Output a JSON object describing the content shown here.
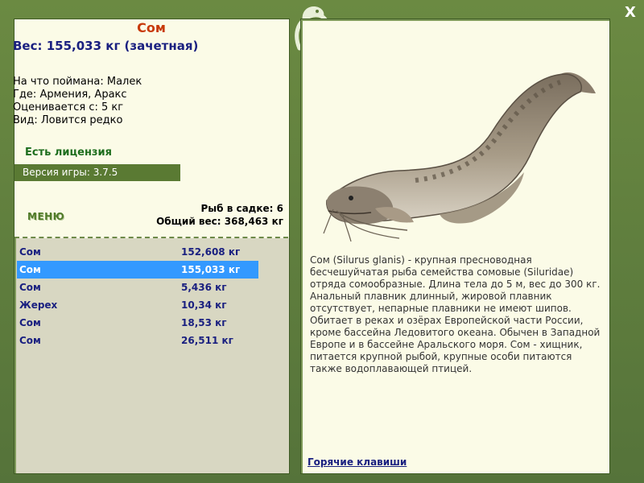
{
  "window": {
    "close_label": "X"
  },
  "fish": {
    "title": "Сом",
    "weight_text": "Вес: 155,033 кг (зачетная)",
    "bait_label": "На что поймана:",
    "bait_value": "Малек",
    "place_label": "Где:",
    "place_value": "Армения, Аракс",
    "rated_label": "Оценивается с:",
    "rated_value": "5 кг",
    "kind_label": "Вид:",
    "kind_value": "Ловится редко"
  },
  "license_text": "Есть лицензия",
  "version_text": "Версия игры: 3.7.5",
  "menu_label": "МЕНЮ",
  "stats": {
    "count_text": "Рыб в садке: 6",
    "total_text": "Общий вес: 368,463 кг"
  },
  "catch_list": [
    {
      "name": "Сом",
      "weight": "152,608 кг",
      "selected": false
    },
    {
      "name": "Сом",
      "weight": "155,033 кг",
      "selected": true
    },
    {
      "name": "Сом",
      "weight": "5,436 кг",
      "selected": false
    },
    {
      "name": "Жерех",
      "weight": "10,34 кг",
      "selected": false
    },
    {
      "name": "Сом",
      "weight": "18,53 кг",
      "selected": false
    },
    {
      "name": "Сом",
      "weight": "26,511 кг",
      "selected": false
    }
  ],
  "description": "Сом (Silurus glanis) - крупная пресноводная бесчешуйчатая рыба семейства сомовые (Siluridae) отряда сомообразные. Длина тела до 5 м, вес до 300 кг. Анальный плавник длинный, жировой плавник отсутствует, непарные плавники не имеют шипов. Обитает в реках и озёрах Европейской части России, кроме бассейна Ледовитого океана. Обычен в Западной Европе и в бассейне Аральского моря. Сом - хищник, питается крупной рыбой, крупные особи питаются также водоплавающей птицей.",
  "hotkeys_label": "Горячие клавиши",
  "colors": {
    "frame": "#5c7a38",
    "panel": "#fbfbe7",
    "title": "#c83a0a",
    "weight": "#1a2080",
    "selection": "#3399ff"
  },
  "icons": {
    "close": "close-icon",
    "logo": "chameleon-logo-icon"
  }
}
